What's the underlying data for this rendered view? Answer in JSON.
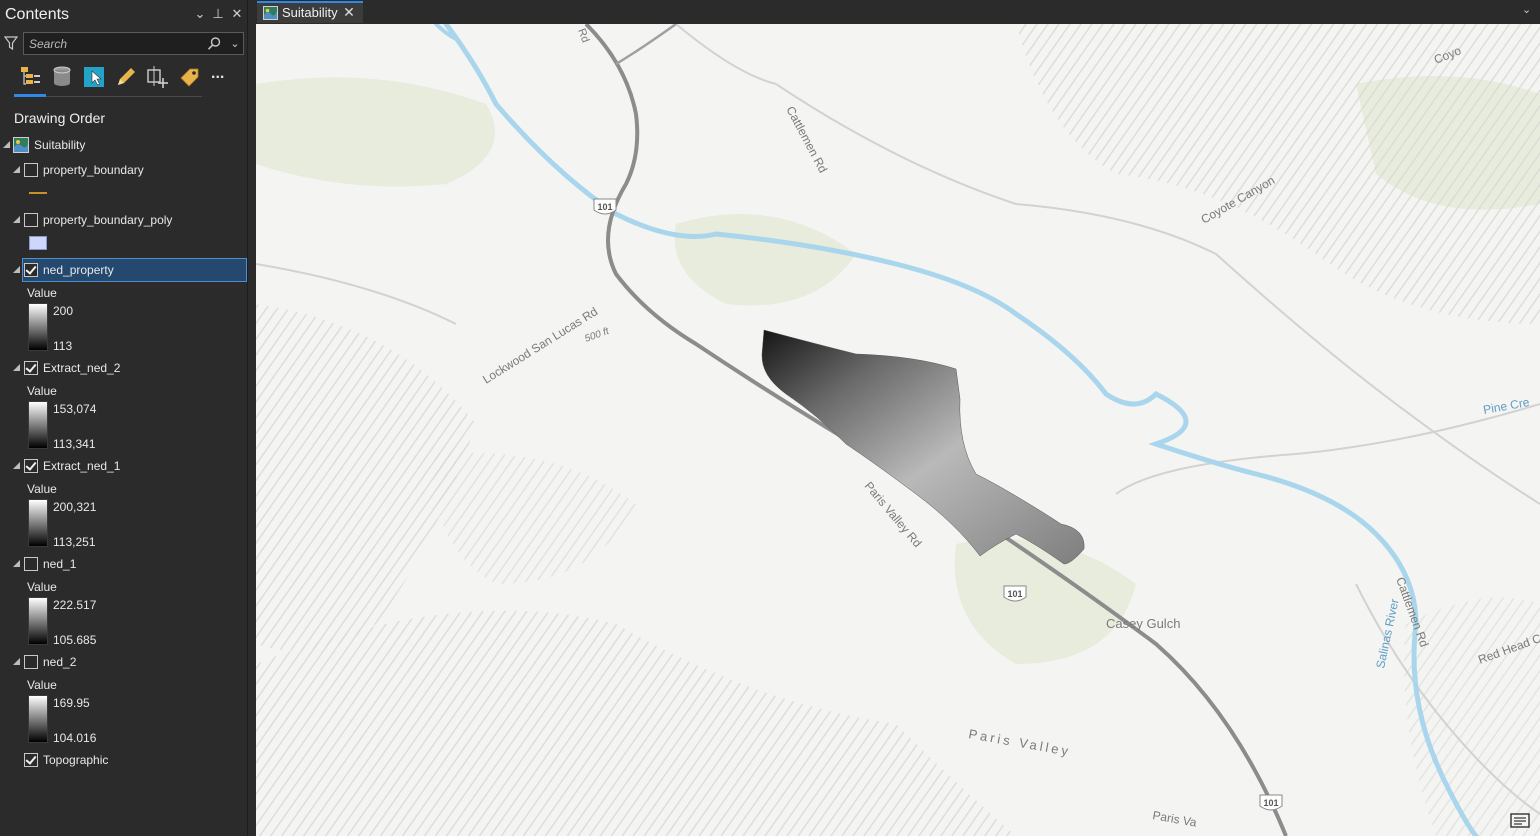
{
  "contents": {
    "title": "Contents",
    "header_buttons": {
      "options": "⌄",
      "pin": "⊥",
      "close": "✕"
    },
    "search": {
      "placeholder": "Search"
    },
    "toolbar": [
      "list-by-drawing-order-icon",
      "list-by-data-source-icon",
      "list-by-selection-icon",
      "list-by-editing-icon",
      "list-by-snapping-icon",
      "list-by-labeling-icon",
      "more-icon"
    ],
    "more_label": "...",
    "section_title": "Drawing Order",
    "map_name": "Suitability",
    "layers": [
      {
        "name": "property_boundary",
        "checked": false,
        "symbol": "line"
      },
      {
        "name": "property_boundary_poly",
        "checked": false,
        "symbol": "polygon"
      },
      {
        "name": "ned_property",
        "checked": true,
        "selected": true,
        "value_label": "Value",
        "high": "200",
        "low": "113"
      },
      {
        "name": "Extract_ned_2",
        "checked": true,
        "value_label": "Value",
        "high": "153,074",
        "low": "113,341"
      },
      {
        "name": "Extract_ned_1",
        "checked": true,
        "value_label": "Value",
        "high": "200,321",
        "low": "113,251"
      },
      {
        "name": "ned_1",
        "checked": false,
        "value_label": "Value",
        "high": "222.517",
        "low": "105.685"
      },
      {
        "name": "ned_2",
        "checked": false,
        "value_label": "Value",
        "high": "169.95",
        "low": "104.016"
      }
    ],
    "basemap": {
      "name": "Topographic",
      "checked": true
    }
  },
  "map_view": {
    "tab_label": "Suitability",
    "tab_close": "✕",
    "strip_dropdown": "⌄"
  },
  "map": {
    "colors": {
      "water": "#a9d6ec",
      "highway": "#8c8c8c",
      "road": "#d2d2d2",
      "land": "#f4f4f2",
      "vegetation": "#e6ecdc"
    },
    "labels": {
      "cattlemen_rd_north": "Cattlemen Rd",
      "coyote_canyon": "Coyote Canyon",
      "coyote_top": "Coyo",
      "lockwood_rd": "Lockwood San Lucas Rd",
      "elev_500": "500 ft",
      "pine_creek": "Pine Cre",
      "paris_valley_rd": "Paris Valley Rd",
      "casey_gulch": "Casey Gulch",
      "paris_valley": "Paris Valley",
      "salinas_river": "Salinas River",
      "cattlemen_rd_south": "Cattlemen Rd",
      "red_head": "Red Head C",
      "paris_va": "Paris Va",
      "rd_top": "Rd",
      "shield_101_a": "101",
      "shield_101_b": "101",
      "shield_101_c": "101"
    }
  }
}
